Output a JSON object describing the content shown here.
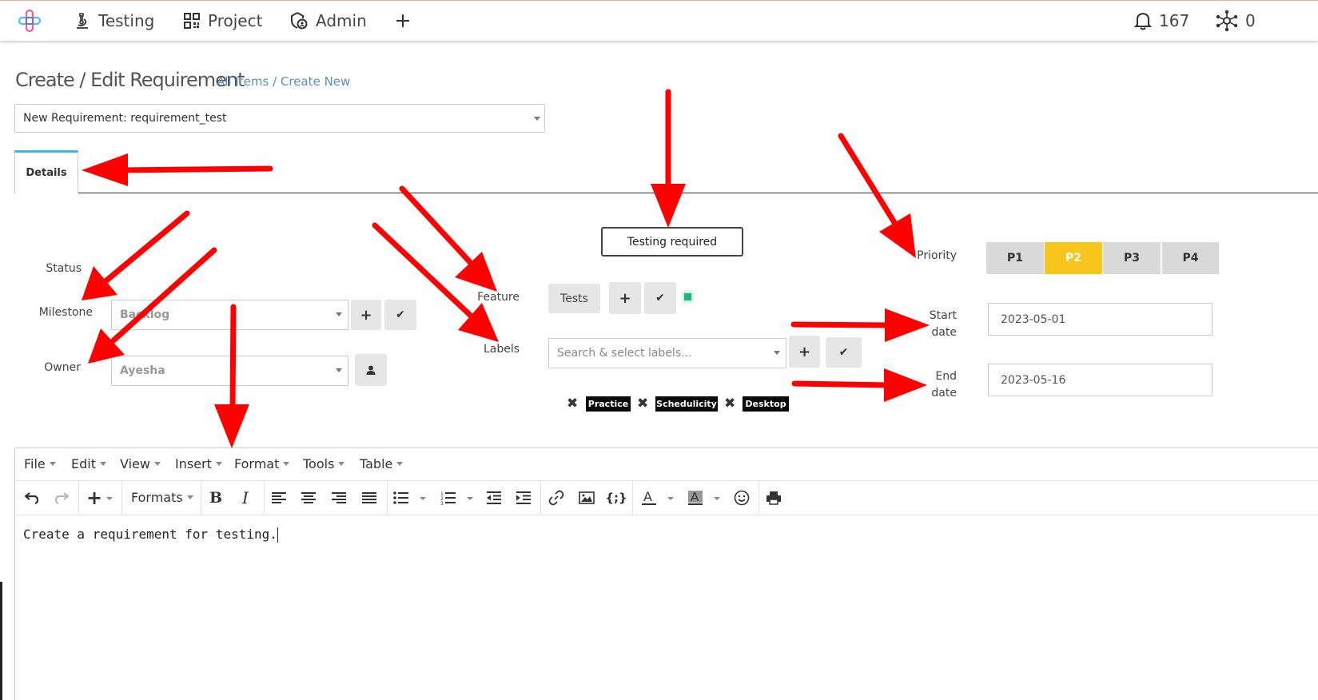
{
  "colors": {
    "accent": "#3fb7e8",
    "priority_active": "#f7c51b",
    "tag_bg": "#0a0a0a",
    "annotation": "#ff0000",
    "status_dot": "#22b57a"
  },
  "nav": {
    "items": [
      {
        "label": "Testing",
        "icon": "microscope-icon"
      },
      {
        "label": "Project",
        "icon": "qr-grid-icon"
      },
      {
        "label": "Admin",
        "icon": "admin-shield-icon"
      }
    ],
    "add_icon": "plus-icon",
    "notifications_count": "167",
    "network_count": "0"
  },
  "page": {
    "title": "Create / Edit Requirement",
    "breadcrumb_all": "All Items",
    "breadcrumb_sep": "/",
    "breadcrumb_current": "Create New"
  },
  "requirement_select": {
    "value": "New Requirement: requirement_test"
  },
  "tabs": [
    {
      "label": "Details"
    }
  ],
  "form": {
    "status_label": "Status",
    "milestone_label": "Milestone",
    "milestone_value": "Backlog",
    "owner_label": "Owner",
    "owner_value": "Ayesha",
    "feature_label": "Feature",
    "feature_value": "Tests",
    "labels_label": "Labels",
    "labels_placeholder": "Search & select labels...",
    "testing_required": "Testing required",
    "priority_label": "Priority",
    "priorities": [
      "P1",
      "P2",
      "P3",
      "P4"
    ],
    "priority_selected": "P2",
    "start_label_1": "Start",
    "start_label_2": "date",
    "start_date": "2023-05-01",
    "end_label_1": "End",
    "end_label_2": "date",
    "end_date": "2023-05-16",
    "tags": [
      "Practice",
      "Schedulicity",
      "Desktop"
    ]
  },
  "editor": {
    "menu": [
      "File",
      "Edit",
      "View",
      "Insert",
      "Format",
      "Tools",
      "Table"
    ],
    "formats_label": "Formats",
    "content": "Create a requirement for testing."
  }
}
